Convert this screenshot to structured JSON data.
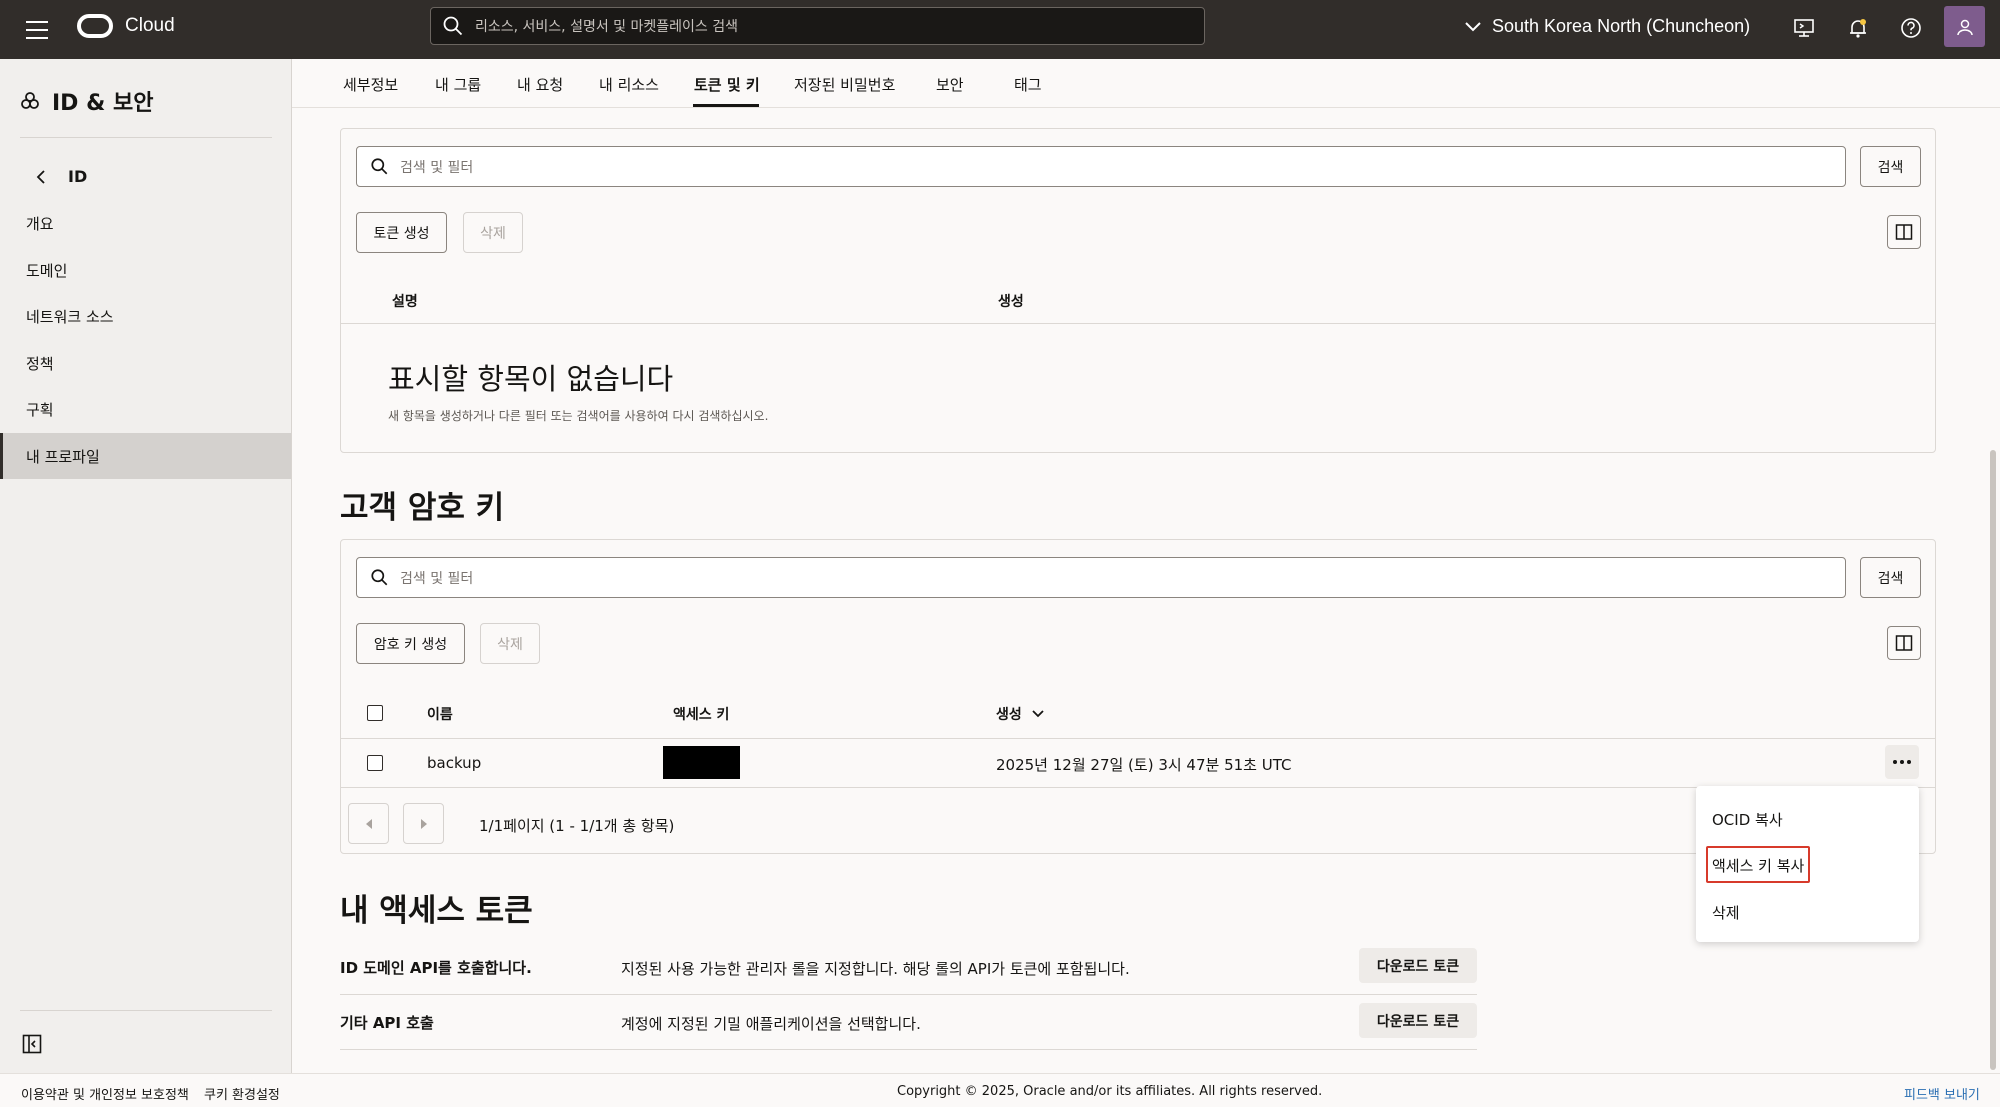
{
  "topbar": {
    "brand": "Cloud",
    "search_placeholder": "리소스, 서비스, 설명서 및 마켓플레이스 검색",
    "region": "South Korea North (Chuncheon)"
  },
  "sidebar": {
    "title": "ID & 보안",
    "back_label": "ID",
    "items": [
      {
        "label": "개요"
      },
      {
        "label": "도메인"
      },
      {
        "label": "네트워크 소스"
      },
      {
        "label": "정책"
      },
      {
        "label": "구획"
      },
      {
        "label": "내 프로파일"
      }
    ],
    "active_index": 5
  },
  "tabs": [
    {
      "label": "세부정보"
    },
    {
      "label": "내 그룹"
    },
    {
      "label": "내 요청"
    },
    {
      "label": "내 리소스"
    },
    {
      "label": "토큰 및 키"
    },
    {
      "label": "저장된 비밀번호"
    },
    {
      "label": "보안"
    },
    {
      "label": "태그"
    }
  ],
  "active_tab": "토큰 및 키",
  "tokens_panel": {
    "filter_placeholder": "검색 및 필터",
    "search_button": "검색",
    "create_button": "토큰 생성",
    "delete_button": "삭제",
    "columns": [
      "설명",
      "생성"
    ],
    "empty_title": "표시할 항목이 없습니다",
    "empty_desc": "새 항목을 생성하거나 다른 필터 또는 검색어를 사용하여 다시 검색하십시오."
  },
  "customer_keys": {
    "title": "고객 암호 키",
    "filter_placeholder": "검색 및 필터",
    "search_button": "검색",
    "create_button": "암호 키 생성",
    "delete_button": "삭제",
    "columns": [
      "이름",
      "액세스 키",
      "생성"
    ],
    "rows": [
      {
        "name": "backup",
        "created": "2025년 12월 27일 (토) 3시 47분 51초 UTC"
      }
    ],
    "pagination": "1/1페이지 (1 - 1/1개 총 항목)"
  },
  "row_menu": {
    "items": [
      "OCID 복사",
      "액세스 키 복사",
      "삭제"
    ],
    "highlighted": "액세스 키 복사"
  },
  "access_tokens": {
    "title": "내 액세스 토큰",
    "rows": [
      {
        "label": "ID 도메인 API를 호출합니다.",
        "desc": "지정된 사용 가능한 관리자 롤을 지정합니다. 해당 롤의 API가 토큰에 포함됩니다.",
        "button": "다운로드 토큰"
      },
      {
        "label": "기타 API 호출",
        "desc": "계정에 지정된 기밀 애플리케이션을 선택합니다.",
        "button": "다운로드 토큰"
      }
    ]
  },
  "footer": {
    "terms": "이용약관 및 개인정보 보호정책",
    "cookies": "쿠키 환경설정",
    "copyright": "Copyright © 2025, Oracle and/or its affiliates. All rights reserved.",
    "feedback": "피드백 보내기"
  },
  "colors": {
    "topbar": "#312d2a",
    "highlight": "#d73a2b",
    "avatar": "#7e5c8d"
  }
}
